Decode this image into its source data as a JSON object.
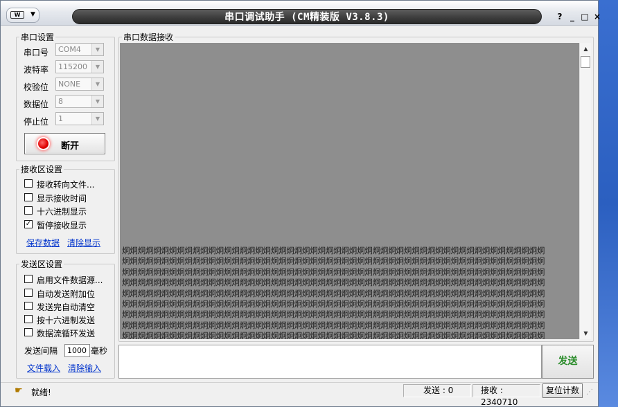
{
  "window": {
    "title": "串口调试助手 (CM精装版 V3.8.3)",
    "sysmenu_logo": "W",
    "sysmenu_arrow": "▼",
    "btn_help": "?",
    "btn_min": "_",
    "btn_max": "□",
    "btn_close": "×"
  },
  "serial_settings": {
    "legend": "串口设置",
    "port_label": "串口号",
    "port_value": "COM4",
    "baud_label": "波特率",
    "baud_value": "115200",
    "parity_label": "校验位",
    "parity_value": "NONE",
    "databits_label": "数据位",
    "databits_value": "8",
    "stopbits_label": "停止位",
    "stopbits_value": "1",
    "connect_button": "断开"
  },
  "receive_settings": {
    "legend": "接收区设置",
    "options": [
      {
        "label": "接收转向文件...",
        "checked": false
      },
      {
        "label": "显示接收时间",
        "checked": false
      },
      {
        "label": "十六进制显示",
        "checked": false
      },
      {
        "label": "暂停接收显示",
        "checked": true
      }
    ],
    "save_link": "保存数据",
    "clear_link": "清除显示"
  },
  "send_settings": {
    "legend": "发送区设置",
    "options": [
      {
        "label": "启用文件数据源...",
        "checked": false
      },
      {
        "label": "自动发送附加位",
        "checked": false
      },
      {
        "label": "发送完自动清空",
        "checked": false
      },
      {
        "label": "按十六进制发送",
        "checked": false
      },
      {
        "label": "数据流循环发送",
        "checked": false
      }
    ],
    "interval_label": "发送间隔",
    "interval_value": "1000",
    "interval_unit": "毫秒",
    "file_link": "文件载入",
    "clear_input_link": "清除输入"
  },
  "receive_area": {
    "legend": "串口数据接收",
    "content_char": "炯",
    "content_rows": 9,
    "content_cols": 54
  },
  "send_area": {
    "value": "",
    "send_button": "发送"
  },
  "statusbar": {
    "ready": "就绪!",
    "sent": "发送 : 0",
    "received": "接收 : 2340710",
    "reset_button": "复位计数"
  },
  "colors": {
    "receive_bg": "#8e8e8e",
    "send_button_text": "#2a8c2a",
    "link": "#0033cc"
  }
}
